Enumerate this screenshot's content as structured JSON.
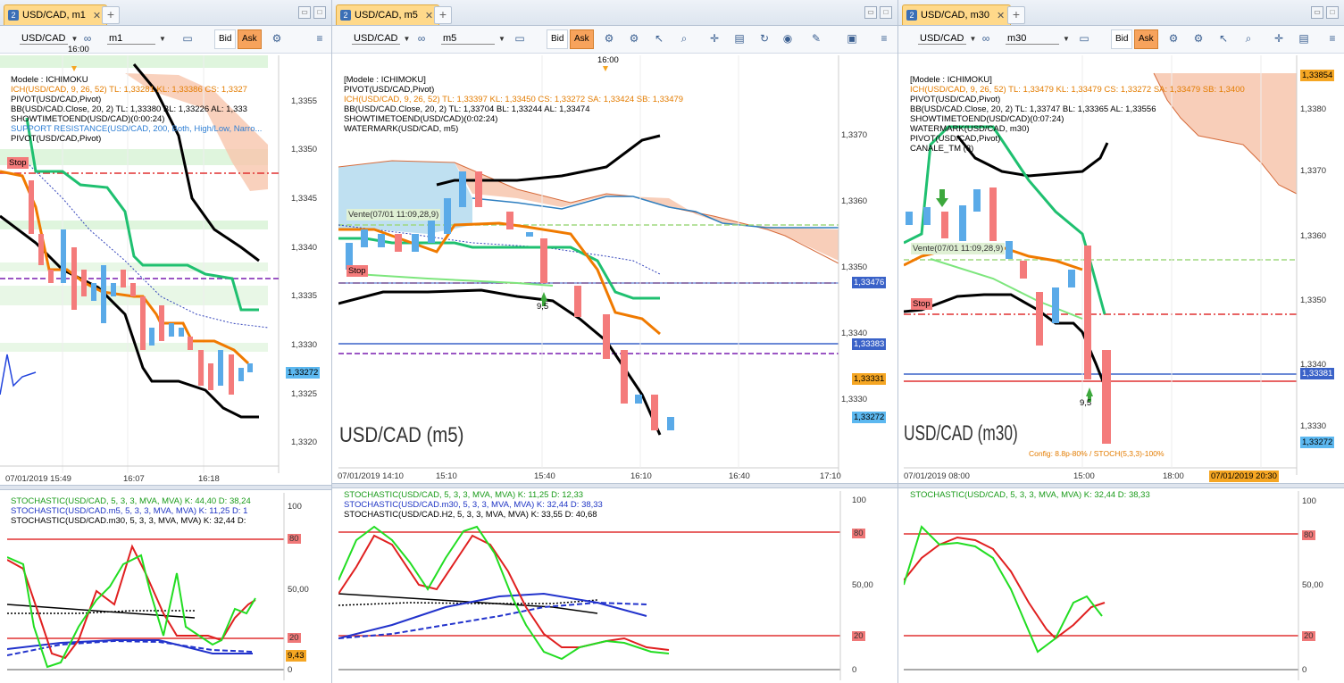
{
  "windows": [
    {
      "tab_number": "2",
      "tab_title": "USD/CAD, m1",
      "symbol": "USD/CAD",
      "timeframe": "m1",
      "bid_label": "Bid",
      "ask_label": "Ask",
      "time_marker": "16:00",
      "legend": [
        {
          "text": "Modele : ICHIMOKU",
          "color": "#000000"
        },
        {
          "text": "ICH(USD/CAD, 9, 26, 52)  TL: 1,33281  KL: 1,33386  CS: 1,3327",
          "color": "#e37c00"
        },
        {
          "text": "PIVOT(USD/CAD,Pivot)",
          "color": "#000000"
        },
        {
          "text": "BB(USD/CAD.Close, 20, 2)  TL: 1,33380  BL: 1,33226  AL: 1,333",
          "color": "#000000"
        },
        {
          "text": "SHOWTIMETOEND(USD/CAD)(0:00:24)",
          "color": "#000000"
        },
        {
          "text": "SUPPORT RESISTANCE(USD/CAD, 200, Both, High/Low, Narro...",
          "color": "#2f7fd4"
        },
        {
          "text": "PIVOT(USD/CAD,Pivot)",
          "color": "#000000"
        }
      ],
      "stop_label": "Stop",
      "price_axis": [
        "1,3355",
        "1,3350",
        "1,3345",
        "1,3340",
        "1,3335",
        "1,3330",
        "1,3325",
        "1,3320"
      ],
      "price_tags": [
        {
          "text": "1,33272",
          "bg": "#5cb8f0",
          "color": "#000000"
        }
      ],
      "time_axis": [
        "07/01/2019 15:49",
        "16:07",
        "16:18"
      ],
      "osc_legend": [
        {
          "text": "STOCHASTIC(USD/CAD, 5, 3, 3, MVA, MVA)  K: 44,40  D: 38,24",
          "color": "#1a9b1a"
        },
        {
          "text": "STOCHASTIC(USD/CAD.m5, 5, 3, 3, MVA, MVA)  K: 11,25  D: 1",
          "color": "#1f35c4"
        },
        {
          "text": "STOCHASTIC(USD/CAD.m30, 5, 3, 3, MVA, MVA)  K: 32,44  D:",
          "color": "#000000"
        }
      ],
      "osc_axis": [
        "100",
        "80",
        "50,00",
        "20",
        "0"
      ],
      "osc_tag": "9,43"
    },
    {
      "tab_number": "2",
      "tab_title": "USD/CAD, m5",
      "symbol": "USD/CAD",
      "timeframe": "m5",
      "bid_label": "Bid",
      "ask_label": "Ask",
      "time_marker": "16:00",
      "legend": [
        {
          "text": "[Modele : ICHIMOKU]",
          "color": "#000000"
        },
        {
          "text": "PIVOT(USD/CAD,Pivot)",
          "color": "#000000"
        },
        {
          "text": "ICH(USD/CAD, 9, 26, 52)  TL: 1,33397  KL: 1,33450  CS: 1,33272  SA: 1,33424  SB: 1,33479",
          "color": "#e37c00"
        },
        {
          "text": "BB(USD/CAD.Close, 20, 2)  TL: 1,33704  BL: 1,33244  AL: 1,33474",
          "color": "#000000"
        },
        {
          "text": "SHOWTIMETOEND(USD/CAD)(0:02:24)",
          "color": "#000000"
        },
        {
          "text": "WATERMARK(USD/CAD, m5)",
          "color": "#000000"
        }
      ],
      "vente_label": "Vente(07/01 11:09,28,9)",
      "stop_label": "Stop",
      "arrow_label": "9,5",
      "watermark": "USD/CAD (m5)",
      "price_axis": [
        "1,3370",
        "1,3360",
        "1,3350",
        "1,3340",
        "1,3330"
      ],
      "price_tags": [
        {
          "text": "1,33476",
          "bg": "#3a62c8",
          "color": "#ffffff"
        },
        {
          "text": "1,33383",
          "bg": "#3a62c8",
          "color": "#ffffff"
        },
        {
          "text": "1,33331",
          "bg": "#f5a623",
          "color": "#000000"
        },
        {
          "text": "1,33272",
          "bg": "#5cb8f0",
          "color": "#000000"
        }
      ],
      "time_axis": [
        "07/01/2019 14:10",
        "15:10",
        "15:40",
        "16:10",
        "16:40",
        "17:10"
      ],
      "osc_legend": [
        {
          "text": "STOCHASTIC(USD/CAD, 5, 3, 3, MVA, MVA)  K: 11,25  D: 12,33",
          "color": "#1a9b1a"
        },
        {
          "text": "STOCHASTIC(USD/CAD.m30, 5, 3, 3, MVA, MVA)  K: 32,44  D: 38,33",
          "color": "#1f35c4"
        },
        {
          "text": "STOCHASTIC(USD/CAD.H2, 5, 3, 3, MVA, MVA)  K: 33,55  D: 40,68",
          "color": "#000000"
        }
      ],
      "osc_axis": [
        "100",
        "80",
        "50,00",
        "20",
        "0"
      ]
    },
    {
      "tab_number": "2",
      "tab_title": "USD/CAD, m30",
      "symbol": "USD/CAD",
      "timeframe": "m30",
      "bid_label": "Bid",
      "ask_label": "Ask",
      "legend": [
        {
          "text": "[Modele : ICHIMOKU]",
          "color": "#000000"
        },
        {
          "text": "ICH(USD/CAD, 9, 26, 52)  TL: 1,33479  KL: 1,33479  CS: 1,33272  SA: 1,33479  SB: 1,3400",
          "color": "#e37c00"
        },
        {
          "text": "PIVOT(USD/CAD,Pivot)",
          "color": "#000000"
        },
        {
          "text": "BB(USD/CAD.Close, 20, 2)  TL: 1,33747  BL: 1,33365  AL: 1,33556",
          "color": "#000000"
        },
        {
          "text": "SHOWTIMETOEND(USD/CAD)(0:07:24)",
          "color": "#000000"
        },
        {
          "text": "WATERMARK(USD/CAD, m30)",
          "color": "#000000"
        },
        {
          "text": "PIVOT(USD/CAD,Pivot)",
          "color": "#000000"
        },
        {
          "text": "CANALE_TM (3)",
          "color": "#000000"
        }
      ],
      "vente_label": "Vente(07/01 11:09,28,9)",
      "stop_label": "Stop",
      "arrow_label": "9,5",
      "watermark": "USD/CAD (m30)",
      "config_note": "Config: 8.8p-80% / STOCH(5,3,3)-100%",
      "price_axis": [
        "1,3380",
        "1,3370",
        "1,3360",
        "1,3350",
        "1,3340",
        "1,3330"
      ],
      "price_tags": [
        {
          "text": "1,33854",
          "bg": "#f5a623",
          "color": "#000000"
        },
        {
          "text": "1,33381",
          "bg": "#3a62c8",
          "color": "#ffffff"
        },
        {
          "text": "1,33272",
          "bg": "#5cb8f0",
          "color": "#000000"
        }
      ],
      "time_axis": [
        "07/01/2019 08:00",
        "15:00",
        "18:00"
      ],
      "time_tag": "07/01/2019 20:30",
      "osc_legend": [
        {
          "text": "STOCHASTIC(USD/CAD, 5, 3, 3, MVA, MVA)  K: 32,44  D: 38,33",
          "color": "#1a9b1a"
        }
      ],
      "osc_axis": [
        "100",
        "80",
        "50,00",
        "20",
        "0"
      ]
    }
  ]
}
